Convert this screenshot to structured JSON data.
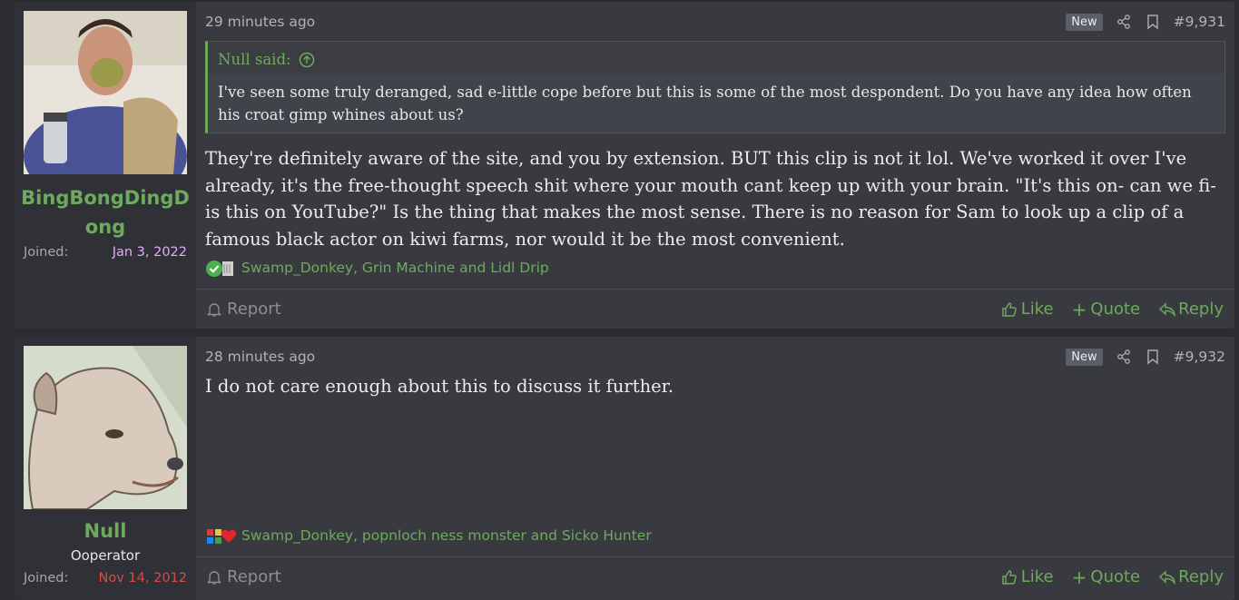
{
  "posts": [
    {
      "user": {
        "name": "BingBongDingDong",
        "title": "",
        "joined_label": "Joined:",
        "joined_date": "Jan 3, 2022",
        "joined_color": "#e7a8ff"
      },
      "time": "29 minutes ago",
      "badge": "New",
      "number": "#9,931",
      "quote": {
        "author": "Null said:",
        "text": "I've seen some truly deranged, sad e-little cope before but this is some of the most despondent. Do you have any idea how often his croat gimp whines about us?"
      },
      "body": "They're definitely aware of the site, and you by extension. BUT this clip is not it lol. We've worked it over I've already, it's the free-thought speech shit where your mouth cant keep up with your brain. \"It's this on- can we fi- is this on YouTube?\" Is the thing that makes the most sense. There is no reason for Sam to look up a clip of a famous black actor on kiwi farms, nor would it be the most convenient.",
      "reactions": "Swamp_Donkey, Grin Machine and Lidl Drip",
      "actions": {
        "report": "Report",
        "like": "Like",
        "quote": "Quote",
        "reply": "Reply"
      }
    },
    {
      "user": {
        "name": "Null",
        "title": "Ooperator",
        "joined_label": "Joined:",
        "joined_date": "Nov 14, 2012",
        "joined_color": "#d94b4b"
      },
      "time": "28 minutes ago",
      "badge": "New",
      "number": "#9,932",
      "body": "I do not care enough about this to discuss it further.",
      "reactions": "Swamp_Donkey, popnloch ness monster and Sicko Hunter",
      "actions": {
        "report": "Report",
        "like": "Like",
        "quote": "Quote",
        "reply": "Reply"
      }
    }
  ],
  "colors": {
    "accent": "#6eaa5e",
    "background": "#2b2c30",
    "post": "#383a40"
  }
}
